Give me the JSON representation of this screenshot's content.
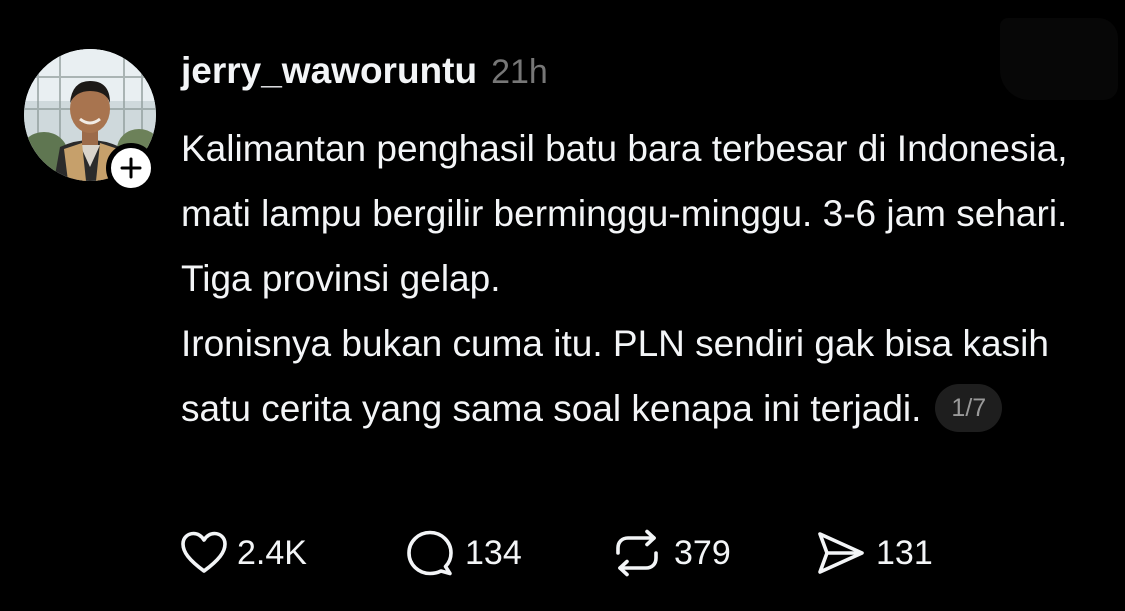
{
  "post": {
    "username": "jerry_waworuntu",
    "time_ago": "21h",
    "paragraphs": [
      "Kalimantan penghasil batu bara terbesar di Indonesia, mati lampu bergilir berminggu-minggu. 3-6 jam sehari. Tiga provinsi gelap.",
      "Ironisnya bukan cuma itu. PLN sendiri gak bisa kasih satu cerita yang sama soal kenapa ini terjadi."
    ],
    "thread_counter": "1/7"
  },
  "actions": {
    "likes": "2.4K",
    "replies": "134",
    "reposts": "379",
    "shares": "131"
  },
  "icons": {
    "like": "heart-icon",
    "reply": "speech-bubble-icon",
    "repost": "repost-arrows-icon",
    "share": "send-icon",
    "follow": "plus-icon"
  },
  "colors": {
    "background": "#000000",
    "text": "#f3f5f7",
    "muted": "#777777",
    "counter_bg": "#1e1e1e"
  }
}
